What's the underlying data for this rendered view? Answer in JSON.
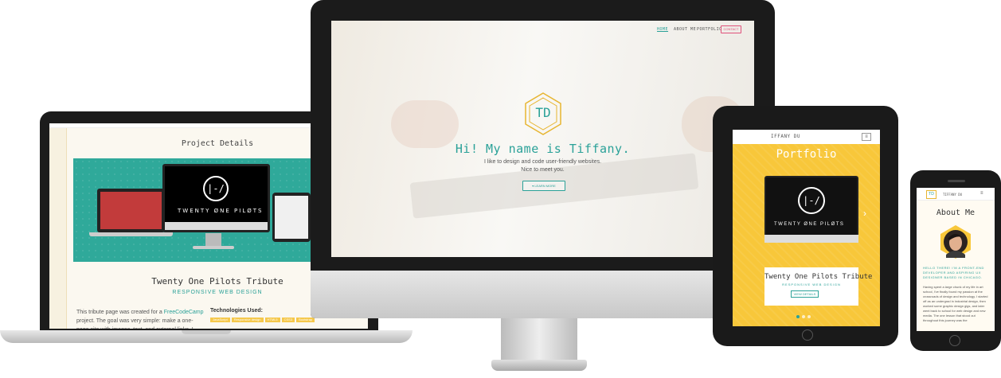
{
  "colors": {
    "teal": "#2aa198",
    "yellow": "#f8c73a",
    "pink": "#e0507a",
    "hero_teal": "#2fa99a"
  },
  "laptop": {
    "partial_top_text": "",
    "section_heading": "Project Details",
    "hero_logo": "|-/",
    "hero_band_text": "TWENTY ØNE PILØTS",
    "project_title": "Twenty One Pilots Tribute",
    "project_subtitle": "RESPONSIVE WEB DESIGN",
    "desc_part1": "This tribute page was created for a ",
    "desc_link": "FreeCodeCamp",
    "desc_part2": " project. The goal was very simple: make a one-page site with images, text, and external links. I took this chance",
    "tech_label": "Technologies Used:",
    "tech_tags": [
      "JavaScript",
      "Responsive design",
      "HTML5",
      "CSS3",
      "Bootstrap"
    ]
  },
  "imac": {
    "nav": {
      "home": "HOME",
      "about": "ABOUT ME",
      "portfolio": "PORTFOLIO",
      "contact": "CONTACT"
    },
    "logo_text": "TD",
    "hero_title": "Hi! My name is Tiffany.",
    "hero_line1": "I like to design and code user-friendly websites.",
    "hero_line2": "Nice to meet you.",
    "learn_more": "▾ LEARN MORE"
  },
  "tablet": {
    "brand": "IFFANY DU",
    "menu_icon": "≡",
    "title": "Portfolio",
    "monitor_logo": "|-/",
    "monitor_band_text": "TWENTY ØNE PILØTS",
    "arrow": "›",
    "card_title": "Twenty One Pilots Tribute",
    "card_subtitle": "RESPONSIVE WEB DESIGN",
    "card_button": "VIEW DETAILS",
    "carousel_active_index": 0
  },
  "phone": {
    "logo": "TD",
    "brand": "TIFFANY DU",
    "menu_icon": "≡",
    "title": "About Me",
    "intro": "HELLO THERE! I'M A FRONT-END DEVELOPER AND ASPIRING UX DESIGNER BASED IN CHICAGO.",
    "body": "Having spent a large chunk of my life in art school, I've finally found my passion at the crossroads of design and technology. I started off as an undergrad in industrial design, then worked some graphic design gigs, and later went back to school for web design and new media. The one lesson that stood out throughout this journey was the"
  }
}
